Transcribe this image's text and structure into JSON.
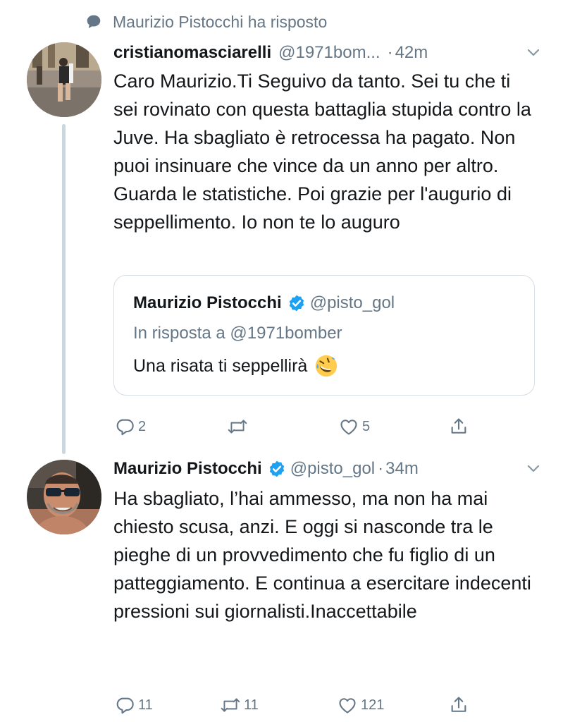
{
  "social_context": {
    "text": "Maurizio Pistocchi ha risposto",
    "icon": "speech-bubble-icon"
  },
  "tweets": [
    {
      "name": "cristianomasciarelli",
      "handle": "@1971bom...",
      "time": "42m",
      "text": "Caro Maurizio.Ti Seguivo da tanto. Sei tu che ti sei rovinato con questa battaglia stupida contro la Juve. Ha sbagliato è retrocessa ha pagato. Non puoi insinuare che vince da un anno per altro. Guarda le statistiche. Poi grazie per l'augurio di seppellimento. Io non te lo auguro",
      "quoted": {
        "name": "Maurizio Pistocchi",
        "verified": true,
        "handle": "@pisto_gol",
        "reply_to": "In risposta a @1971bomber",
        "text": "Una risata ti seppellirà",
        "emoji": "rolling-on-floor-laughing"
      },
      "actions": {
        "replies": "2",
        "retweets": "",
        "likes": "5"
      }
    },
    {
      "name": "Maurizio Pistocchi",
      "verified": true,
      "handle": "@pisto_gol",
      "time": "34m",
      "text": "Ha sbagliato, l’hai ammesso, ma non ha mai chiesto scusa, anzi. E oggi si nasconde tra le pieghe di un provvedimento che fu figlio di un patteggiamento. E continua a esercitare indecenti pressioni sui giornalisti.Inaccettabile",
      "actions": {
        "replies": "11",
        "retweets": "11",
        "likes": "121"
      }
    }
  ],
  "colors": {
    "text": "#14171a",
    "secondary": "#657786",
    "verified_blue": "#1da1f2",
    "thread_line": "#ccd6dd",
    "border": "#d6dde3"
  }
}
